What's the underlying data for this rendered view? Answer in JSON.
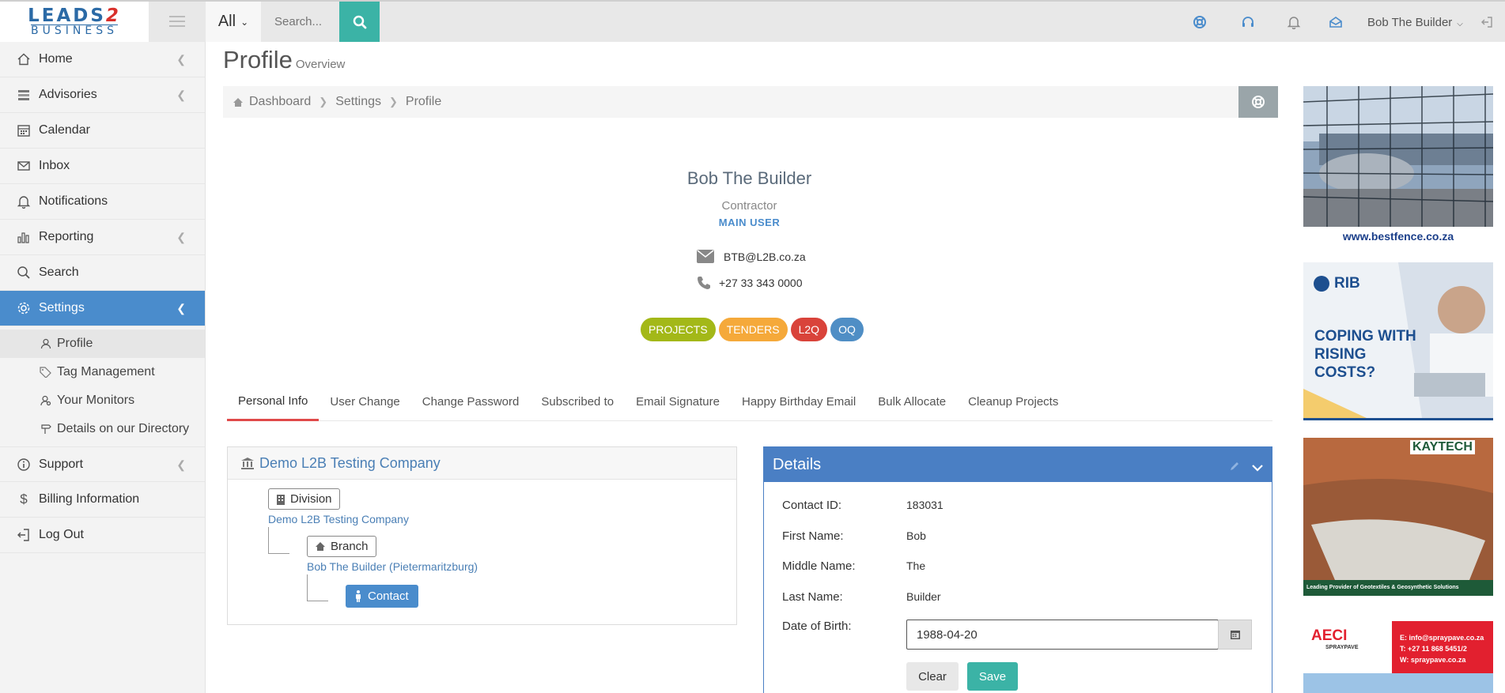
{
  "header": {
    "logo_top": "LEADS",
    "logo_two": "2",
    "logo_bottom": "BUSINESS",
    "search_scope": "All",
    "search_placeholder": "Search...",
    "user_name": "Bob The Builder"
  },
  "sidebar": {
    "items": [
      {
        "label": "Home"
      },
      {
        "label": "Advisories"
      },
      {
        "label": "Calendar"
      },
      {
        "label": "Inbox"
      },
      {
        "label": "Notifications"
      },
      {
        "label": "Reporting"
      },
      {
        "label": "Search"
      },
      {
        "label": "Settings"
      },
      {
        "label": "Support"
      },
      {
        "label": "Billing Information"
      },
      {
        "label": "Log Out"
      }
    ],
    "subitems": [
      {
        "label": "Profile"
      },
      {
        "label": "Tag Management"
      },
      {
        "label": "Your Monitors"
      },
      {
        "label": "Details on our Directory"
      }
    ]
  },
  "page": {
    "title": "Profile",
    "subtitle": "Overview",
    "breadcrumb": [
      "Dashboard",
      "Settings",
      "Profile"
    ]
  },
  "profile": {
    "name": "Bob The Builder",
    "role": "Contractor",
    "user_type": "MAIN USER",
    "email": "BTB@L2B.co.za",
    "phone": "+27 33 343 0000",
    "badges": [
      {
        "label": "PROJECTS",
        "color": "#a3b818"
      },
      {
        "label": "TENDERS",
        "color": "#f5a93a"
      },
      {
        "label": "L2Q",
        "color": "#d9433a"
      },
      {
        "label": "OQ",
        "color": "#4f8ec5"
      }
    ]
  },
  "tabs": [
    "Personal Info",
    "User Change",
    "Change Password",
    "Subscribed to",
    "Email Signature",
    "Happy Birthday Email",
    "Bulk Allocate",
    "Cleanup Projects"
  ],
  "company": {
    "name": "Demo L2B Testing Company",
    "division_label": "Division",
    "division_name": "Demo L2B Testing Company",
    "branch_label": "Branch",
    "branch_name": "Bob The Builder (Pietermaritzburg)",
    "contact_label": "Contact"
  },
  "details": {
    "title": "Details",
    "fields": [
      {
        "label": "Contact ID:",
        "value": "183031"
      },
      {
        "label": "First Name:",
        "value": "Bob"
      },
      {
        "label": "Middle Name:",
        "value": "The"
      },
      {
        "label": "Last Name:",
        "value": "Builder"
      }
    ],
    "dob_label": "Date of Birth:",
    "dob_value": "1988-04-20",
    "clear_label": "Clear",
    "save_label": "Save"
  },
  "ads": {
    "ad1_url": "www.bestfence.co.za",
    "ad2_brand": "RIB",
    "ad2_headline": "COPING WITH RISING COSTS?",
    "ad3_brand": "KAYTECH",
    "ad3_caption": "Leading Provider of Geotextiles & Geosynthetic Solutions",
    "ad4_brand": "AECI",
    "ad4_sub": "SPRAYPAVE",
    "ad4_email": "E: info@spraypave.co.za",
    "ad4_tel": "T: +27 11 868 5451/2",
    "ad4_web": "W: spraypave.co.za"
  }
}
